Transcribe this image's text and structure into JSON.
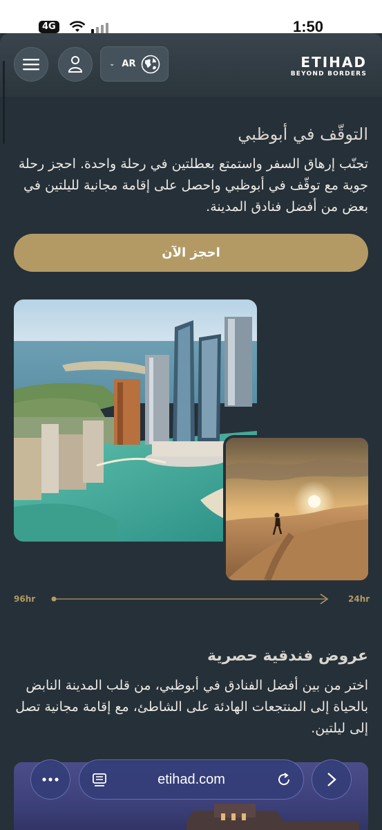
{
  "status_bar": {
    "signal": "4G",
    "time": "1:50"
  },
  "header": {
    "language": "AR",
    "brand_name": "ETIHAD",
    "brand_tagline": "BEYOND BORDERS"
  },
  "stopover": {
    "title": "التوقّف في أبوظبي",
    "body": "تجنّب إرهاق السفر واستمتع بعطلتين في رحلة واحدة. احجز رحلة جوية مع توقّف في أبوظبي واحصل على إقامة مجانية لليلتين في بعض من أفضل فنادق المدينة.",
    "cta_label": "احجز الآن"
  },
  "timeline": {
    "start_label": "96hr",
    "end_label": "24hr"
  },
  "hotel_offers": {
    "title": "عروض فندقية حصرية",
    "body": "اختر من بين أفضل الفنادق في أبوظبي، من قلب المدينة النابض بالحياة إلى المنتجعات الهادئة على الشاطئ، مع إقامة مجانية تصل إلى ليلتين."
  },
  "browser": {
    "url": "etihad.com"
  },
  "colors": {
    "background": "#263038",
    "gold": "#b39a65",
    "header": "#3a444c"
  }
}
